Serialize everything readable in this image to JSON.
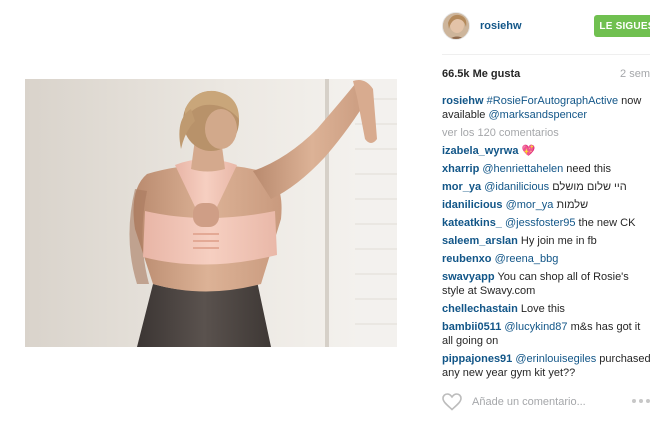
{
  "post": {
    "username": "rosiehw",
    "follow_label": "LE SIGUES",
    "likes": "66.5k Me gusta",
    "time": "2 sem",
    "caption": {
      "user": "rosiehw",
      "tag": "#RosieForAutographActive",
      "text": " now available ",
      "mention": "@marksandspencer"
    },
    "view_all": "ver los 120 comentarios",
    "comments": [
      {
        "user": "izabela_wyrwa",
        "mention": "",
        "text": " 💖"
      },
      {
        "user": "xharrip",
        "mention": "@henriettahelen",
        "text": " need this"
      },
      {
        "user": "mor_ya",
        "mention": "@idanilicious",
        "text": " היי שלום מושלם"
      },
      {
        "user": "idanilicious",
        "mention": "@mor_ya",
        "text": " שלמות"
      },
      {
        "user": "kateatkins_",
        "mention": "@jessfoster95",
        "text": " the new CK"
      },
      {
        "user": "saleem_arslan",
        "mention": "",
        "text": " Hy join me in fb"
      },
      {
        "user": "reubenxo",
        "mention": "@reena_bbg",
        "text": ""
      },
      {
        "user": "swavyapp",
        "mention": "",
        "text": " You can shop all of Rosie's style at Swavy.com"
      },
      {
        "user": "chellechastain",
        "mention": "",
        "text": " Love this"
      },
      {
        "user": "bambii0511",
        "mention": "@lucykind87",
        "text": " m&s has got it all going on"
      },
      {
        "user": "pippajones91",
        "mention": "@erinlouisegiles",
        "text": " purchased any new year gym kit yet??"
      }
    ],
    "comment_placeholder": "Añade un comentario...",
    "icons": {
      "like": "heart-outline-icon",
      "more": "more-dots-icon"
    },
    "colors": {
      "link": "#125688",
      "follow": "#70c050",
      "muted": "#a5a7aa"
    }
  }
}
